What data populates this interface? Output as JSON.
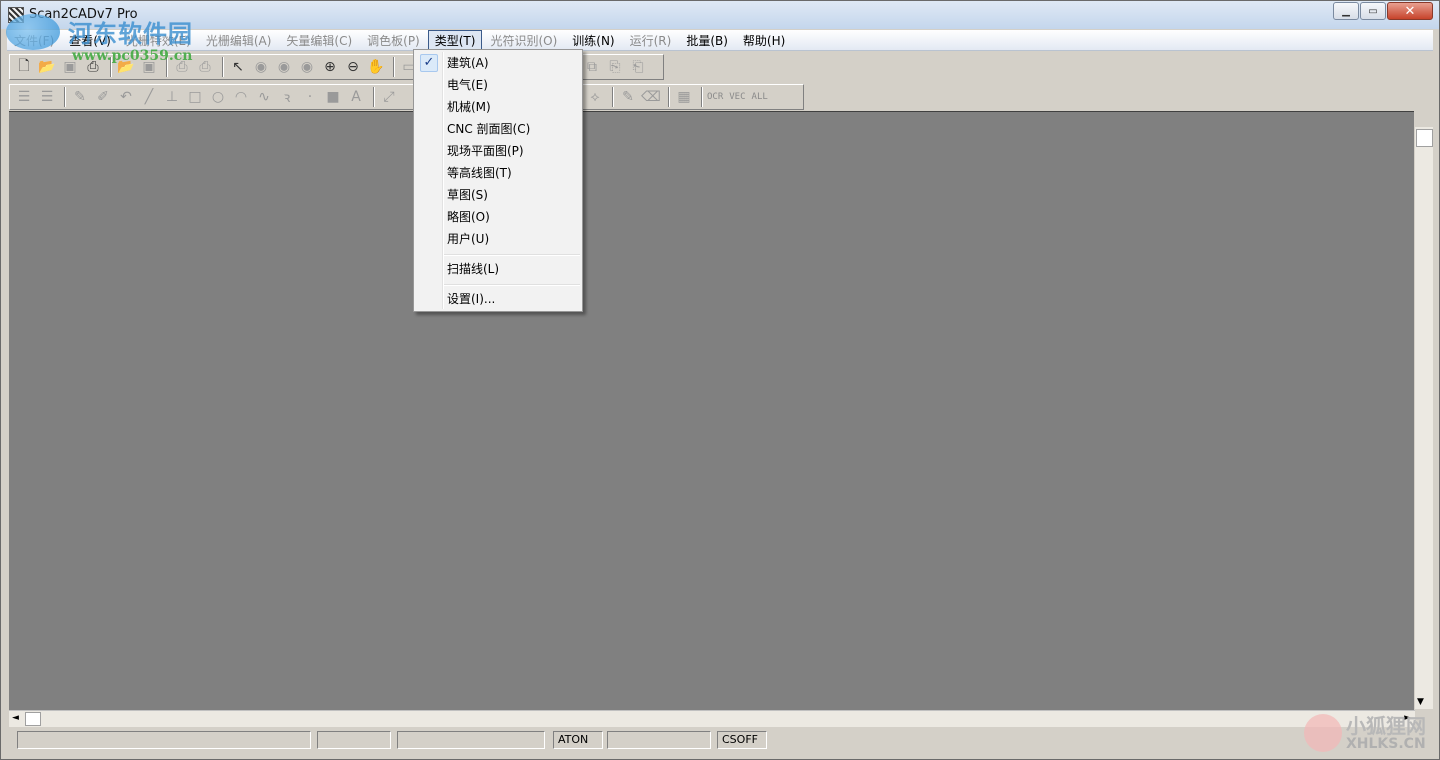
{
  "window": {
    "title": "Scan2CADv7 Pro",
    "controls": {
      "minimize": "▁",
      "maximize": "▭",
      "close": "✕"
    }
  },
  "watermark_top": {
    "text": "河东软件园",
    "url": "www.pc0359.cn"
  },
  "watermark_bottom": {
    "text": "小狐狸网",
    "url": "XHLKS.CN"
  },
  "menu": {
    "items": [
      {
        "label": "文件(F)",
        "state": "disabled"
      },
      {
        "label": "查看(V)",
        "state": "normal"
      },
      {
        "label": "光栅特效(E)",
        "state": "disabled"
      },
      {
        "label": "光栅编辑(A)",
        "state": "disabled"
      },
      {
        "label": "矢量编辑(C)",
        "state": "disabled"
      },
      {
        "label": "调色板(P)",
        "state": "disabled"
      },
      {
        "label": "类型(T)",
        "state": "active"
      },
      {
        "label": "光符识别(O)",
        "state": "disabled"
      },
      {
        "label": "训练(N)",
        "state": "normal"
      },
      {
        "label": "运行(R)",
        "state": "disabled"
      },
      {
        "label": "批量(B)",
        "state": "normal"
      },
      {
        "label": "帮助(H)",
        "state": "normal"
      }
    ]
  },
  "type_menu": {
    "check_glyph": "✓",
    "items": [
      {
        "label": "建筑(A)",
        "checked": true
      },
      {
        "label": "电气(E)",
        "checked": false
      },
      {
        "label": "机械(M)",
        "checked": false
      },
      {
        "label": "CNC 剖面图(C)",
        "checked": false
      },
      {
        "label": "现场平面图(P)",
        "checked": false
      },
      {
        "label": "等高线图(T)",
        "checked": false
      },
      {
        "label": "草图(S)",
        "checked": false
      },
      {
        "label": "略图(O)",
        "checked": false
      },
      {
        "label": "用户(U)",
        "checked": false
      }
    ],
    "scanline": "扫描线(L)",
    "settings": "设置(I)..."
  },
  "toolbar2_text_buttons": [
    "OCR",
    "VEC",
    "ALL"
  ],
  "statusbar": {
    "panels": [
      "",
      "",
      "",
      "ATON",
      "",
      "CSOFF"
    ]
  },
  "scroll": {
    "up": "▲",
    "down": "▼",
    "left": "◄",
    "right": "►"
  }
}
